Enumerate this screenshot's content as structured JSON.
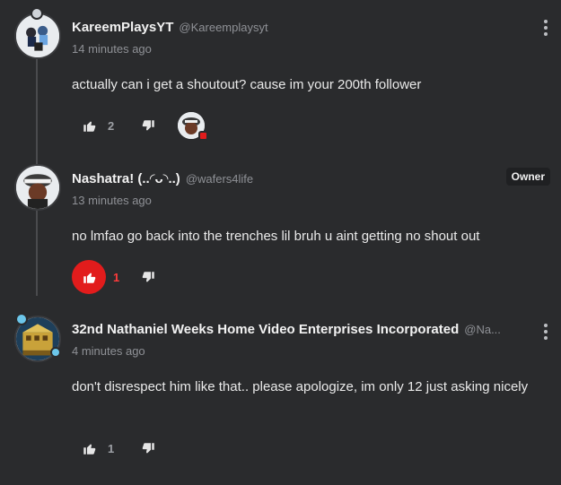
{
  "comments": [
    {
      "author": "KareemPlaysYT",
      "handle": "@Kareemplaysyt",
      "time": "14 minutes ago",
      "text": "actually can i get a shoutout? cause im your 200th follower",
      "likes": "2",
      "liked": false,
      "creator_hearted": true
    },
    {
      "author": "Nashatra! (..◜ᴗ◝..)",
      "handle": "@wafers4life",
      "time": "13 minutes ago",
      "text": "no lmfao go back into the trenches lil bruh u aint getting no shout out",
      "likes": "1",
      "liked": true,
      "badge": "Owner"
    },
    {
      "author": "32nd Nathaniel Weeks Home Video Enterprises Incorporated",
      "handle": "@Na...",
      "time": "4 minutes ago",
      "text": "don't disrespect him like that.. please apologize, im only 12 just asking nicely",
      "likes": "1",
      "liked": false
    }
  ],
  "icons": {
    "like": "thumbs-up-icon",
    "dislike": "thumbs-down-icon",
    "menu": "more-vertical-icon"
  },
  "colors": {
    "background": "#2a2b2d",
    "liked": "#e21c1c",
    "muted_text": "#8f9196"
  }
}
